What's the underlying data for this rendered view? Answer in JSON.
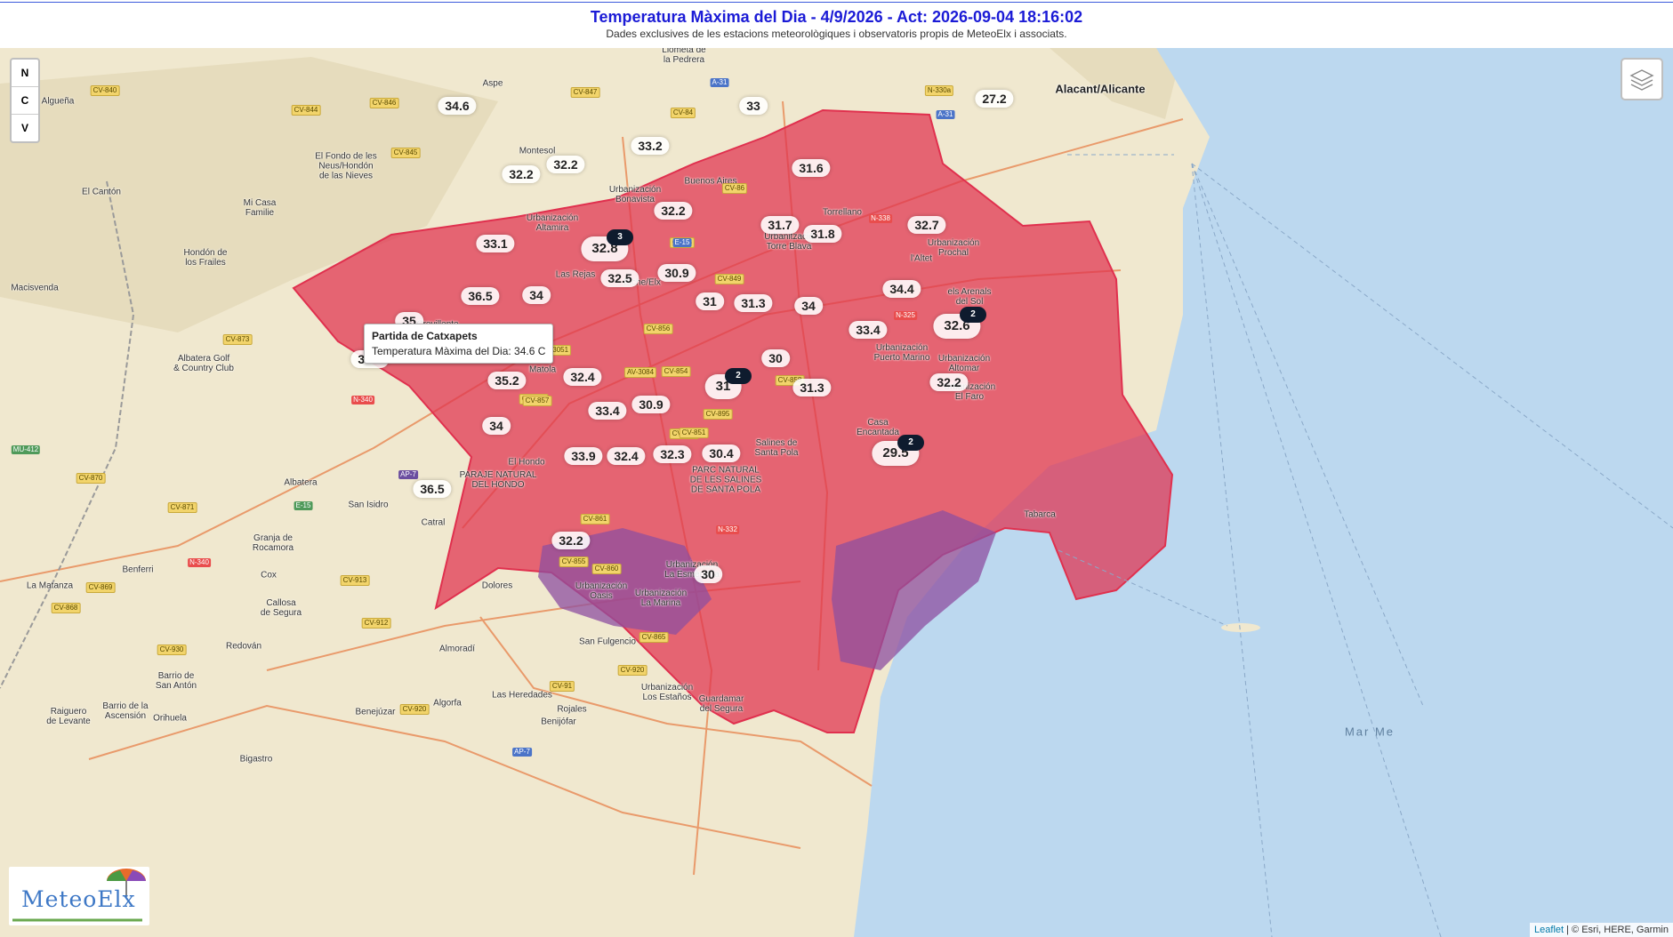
{
  "header": {
    "title": "Temperatura Màxima del Dia - 4/9/2026 - Act: 2026-09-04 18:16:02",
    "subtitle": "Dades exclusives de les estacions meteorològiques i observatoris propis de MeteoElx i associats."
  },
  "controls": {
    "n": "N",
    "c": "C",
    "v": "V"
  },
  "tooltip": {
    "title": "Partida de Catxapets",
    "text": "Temperatura Màxima del Dia: 34.6 C"
  },
  "logo": {
    "text": "MeteoElx"
  },
  "attribution": {
    "leaflet": "Leaflet",
    "rest": " | © Esri, HERE, Garmin"
  },
  "colors": {
    "temperature_zone": "#e0304e",
    "wetland_zone": "#8d4fa0",
    "sea": "#bcd8ef",
    "land": "#f0e8cf"
  },
  "places": [
    {
      "id": "llometa",
      "text": "Llometa de\nla Pedrera",
      "big": false
    },
    {
      "id": "aspe",
      "text": "Aspe",
      "big": false
    },
    {
      "id": "alguena",
      "text": "Algueña",
      "big": false
    },
    {
      "id": "alacant",
      "text": "Alacant/Alicante",
      "big": true
    },
    {
      "id": "montesol",
      "text": "Montesol",
      "big": false
    },
    {
      "id": "fondo",
      "text": "El Fondo de les\nNeus/Hondón\nde las Nieves",
      "big": false
    },
    {
      "id": "canton",
      "text": "El Cantón",
      "big": false
    },
    {
      "id": "micasa",
      "text": "Mi Casa\nFamilie",
      "big": false
    },
    {
      "id": "buenosaires",
      "text": "Buenos Aires",
      "big": false
    },
    {
      "id": "bonavista",
      "text": "Urbanización\nBonavista",
      "big": false
    },
    {
      "id": "torrellano",
      "text": "Torrellano",
      "big": false
    },
    {
      "id": "altamira",
      "text": "Urbanización\nAltamira",
      "big": false
    },
    {
      "id": "torreblava",
      "text": "Urbanització\nTorre Blava",
      "big": false
    },
    {
      "id": "prochal",
      "text": "Urbanización\nProchal",
      "big": false
    },
    {
      "id": "hondon",
      "text": "Hondón de\nlos Frailes",
      "big": false
    },
    {
      "id": "lasrejas",
      "text": "Las Rejas",
      "big": false
    },
    {
      "id": "elche",
      "text": "Elche/Elx",
      "big": false
    },
    {
      "id": "laltet",
      "text": "l'Altet",
      "big": false
    },
    {
      "id": "macisvenda",
      "text": "Macisvenda",
      "big": false
    },
    {
      "id": "arenals",
      "text": "els Arenals\ndel Sol",
      "big": false
    },
    {
      "id": "crevillente",
      "text": "Crevillente",
      "big": false
    },
    {
      "id": "campillos",
      "text": "Campillos",
      "big": false
    },
    {
      "id": "marina",
      "text": "Urbanización\nPuerto Marino",
      "big": false
    },
    {
      "id": "altomar",
      "text": "Urbanización\nAltomar",
      "big": false
    },
    {
      "id": "albatera_golf",
      "text": "Albatera Golf\n& Country Club",
      "big": false
    },
    {
      "id": "matola",
      "text": "Matola",
      "big": false
    },
    {
      "id": "elfaro",
      "text": "Urbanización\nEl Faro",
      "big": false
    },
    {
      "id": "casaencantada",
      "text": "Casa\nEncantada",
      "big": false
    },
    {
      "id": "elhondo",
      "text": "El Hondo",
      "big": false
    },
    {
      "id": "hondo_park",
      "text": "PARAJE NATURAL\nDEL HONDO",
      "big": false
    },
    {
      "id": "salines_park",
      "text": "PARC NATURAL\nDE LES SALINES\nDE SANTA POLA",
      "big": false
    },
    {
      "id": "salines",
      "text": "Salines de\nSanta Pola",
      "big": false
    },
    {
      "id": "albatera",
      "text": "Albatera",
      "big": false
    },
    {
      "id": "sanisidro",
      "text": "San Isidro",
      "big": false
    },
    {
      "id": "catral",
      "text": "Catral",
      "big": false
    },
    {
      "id": "tabarca",
      "text": "Tabarca",
      "big": false
    },
    {
      "id": "granja",
      "text": "Granja de\nRocamora",
      "big": false
    },
    {
      "id": "benferri",
      "text": "Benferri",
      "big": false
    },
    {
      "id": "cox",
      "text": "Cox",
      "big": false
    },
    {
      "id": "lamatanza",
      "text": "La Matanza",
      "big": false
    },
    {
      "id": "dolores",
      "text": "Dolores",
      "big": false
    },
    {
      "id": "callosa",
      "text": "Callosa\nde Segura",
      "big": false
    },
    {
      "id": "oasis",
      "text": "Urbanización\nOasis",
      "big": false
    },
    {
      "id": "lamarina",
      "text": "Urbanización\nLa Marina",
      "big": false
    },
    {
      "id": "esmeralda",
      "text": "Urbanización\nLa Esmeralda",
      "big": false
    },
    {
      "id": "redovan",
      "text": "Redován",
      "big": false
    },
    {
      "id": "sanfulgencio",
      "text": "San Fulgencio",
      "big": false
    },
    {
      "id": "almoradi",
      "text": "Almoradí",
      "big": false
    },
    {
      "id": "barrio_sanant",
      "text": "Barrio de\nSan Antón",
      "big": false
    },
    {
      "id": "lasheredades",
      "text": "Las Heredades",
      "big": false
    },
    {
      "id": "estanos",
      "text": "Urbanización\nLos Estaños",
      "big": false
    },
    {
      "id": "guardamar",
      "text": "Guardamar\ndel Segura",
      "big": false
    },
    {
      "id": "raiguero",
      "text": "Raiguero\nde Levante",
      "big": false
    },
    {
      "id": "barrio_asc",
      "text": "Barrio de la\nAscensión",
      "big": false
    },
    {
      "id": "orihuela",
      "text": "Orihuela",
      "big": false
    },
    {
      "id": "benejuzar",
      "text": "Benejúzar",
      "big": false
    },
    {
      "id": "algorfa",
      "text": "Algorfa",
      "big": false
    },
    {
      "id": "rojales",
      "text": "Rojales",
      "big": false
    },
    {
      "id": "benijofar",
      "text": "Benijófar",
      "big": false
    },
    {
      "id": "bigastro",
      "text": "Bigastro",
      "big": false
    },
    {
      "id": "mar",
      "text": "Mar  Me",
      "big": false
    }
  ],
  "roads": [
    {
      "text": "CV-840",
      "c": "y"
    },
    {
      "text": "CV-846",
      "c": "y"
    },
    {
      "text": "CV-844",
      "c": "y"
    },
    {
      "text": "CV-845",
      "c": "y"
    },
    {
      "text": "CV-847",
      "c": "y"
    },
    {
      "text": "A-31",
      "c": "b"
    },
    {
      "text": "N-330a",
      "c": "y"
    },
    {
      "text": "A-31",
      "c": "b"
    },
    {
      "text": "CV-84",
      "c": "y"
    },
    {
      "text": "CV-86",
      "c": "y"
    },
    {
      "text": "CV-85",
      "c": "y"
    },
    {
      "text": "CV-873",
      "c": "y"
    },
    {
      "text": "CV-850",
      "c": "y"
    },
    {
      "text": "N-338",
      "c": "r"
    },
    {
      "text": "N-332",
      "c": "r"
    },
    {
      "text": "N-340",
      "c": "r"
    },
    {
      "text": "AP-7",
      "c": "p"
    },
    {
      "text": "CV-870",
      "c": "y"
    },
    {
      "text": "CV-871",
      "c": "y"
    },
    {
      "text": "CV-869",
      "c": "y"
    },
    {
      "text": "CV-868",
      "c": "y"
    },
    {
      "text": "N-340",
      "c": "r"
    },
    {
      "text": "CV-913",
      "c": "y"
    },
    {
      "text": "CV-912",
      "c": "y"
    },
    {
      "text": "CV-859",
      "c": "y"
    },
    {
      "text": "CV-895",
      "c": "y"
    },
    {
      "text": "CV-920",
      "c": "y"
    },
    {
      "text": "CV-91",
      "c": "y"
    },
    {
      "text": "CV-930",
      "c": "y"
    },
    {
      "text": "CV-920",
      "c": "y"
    },
    {
      "text": "AP-7",
      "c": "b"
    },
    {
      "text": "MU-412",
      "c": "g"
    },
    {
      "text": "E-15",
      "c": "g"
    },
    {
      "text": "N-332",
      "c": "r"
    },
    {
      "text": "CV-855",
      "c": "y"
    },
    {
      "text": "CV-860",
      "c": "y"
    },
    {
      "text": "CV-861",
      "c": "y"
    },
    {
      "text": "CV-857",
      "c": "y"
    },
    {
      "text": "CV-851",
      "c": "y"
    },
    {
      "text": "CV-865",
      "c": "y"
    },
    {
      "text": "CV-856",
      "c": "y"
    },
    {
      "text": "CV-854",
      "c": "y"
    },
    {
      "text": "CV-849",
      "c": "y"
    },
    {
      "text": "AV-3051",
      "c": "y"
    },
    {
      "text": "AV-3084",
      "c": "y"
    },
    {
      "text": "CV-858",
      "c": "y"
    },
    {
      "text": "N-325",
      "c": "r"
    },
    {
      "text": "E-15",
      "c": "b"
    }
  ],
  "stations": [
    {
      "value": "34.6"
    },
    {
      "value": "33"
    },
    {
      "value": "27.2"
    },
    {
      "value": "33.2"
    },
    {
      "value": "32.2"
    },
    {
      "value": "32.2"
    },
    {
      "value": "31.6"
    },
    {
      "value": "32.2"
    },
    {
      "value": "31.7"
    },
    {
      "value": "32.7"
    },
    {
      "value": "33.1"
    },
    {
      "value": "32.8",
      "size": "lg"
    },
    {
      "value": "31.8"
    },
    {
      "value": "36.5"
    },
    {
      "value": "34"
    },
    {
      "value": "32.5"
    },
    {
      "value": "30.9"
    },
    {
      "value": "34.4"
    },
    {
      "value": "31"
    },
    {
      "value": "31.3"
    },
    {
      "value": "34"
    },
    {
      "value": "32.6",
      "size": "lg"
    },
    {
      "value": "35"
    },
    {
      "value": "33.4"
    },
    {
      "value": "34.6"
    },
    {
      "value": "30"
    },
    {
      "value": "35.2"
    },
    {
      "value": "32.4"
    },
    {
      "value": "31",
      "size": "lg"
    },
    {
      "value": "31.3"
    },
    {
      "value": "32.2"
    },
    {
      "value": "33.4"
    },
    {
      "value": "30.9"
    },
    {
      "value": "34"
    },
    {
      "value": "33.9"
    },
    {
      "value": "32.4"
    },
    {
      "value": "32.3"
    },
    {
      "value": "30.4"
    },
    {
      "value": "29.5",
      "size": "lg"
    },
    {
      "value": "36.5"
    },
    {
      "value": "32.2"
    },
    {
      "value": "30"
    }
  ],
  "clusters": [
    {
      "count": "3"
    },
    {
      "count": "2"
    },
    {
      "count": "2"
    },
    {
      "count": "2"
    }
  ]
}
